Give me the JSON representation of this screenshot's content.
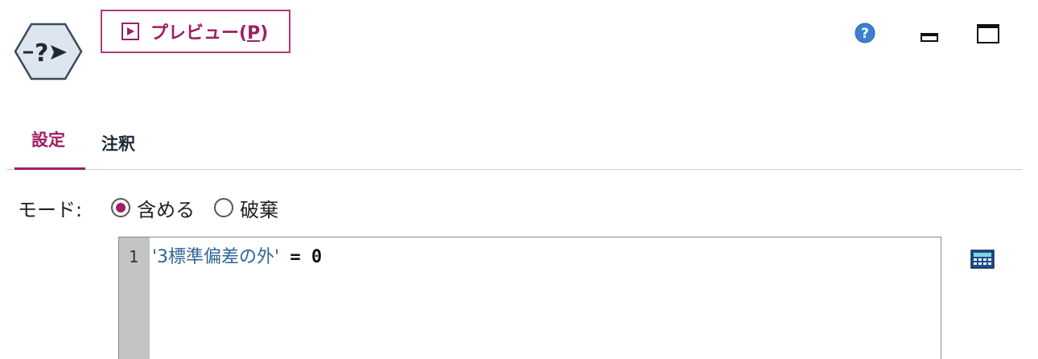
{
  "header": {
    "node_icon": "select-node-icon",
    "preview_button": {
      "icon": "play-icon",
      "label": "プレビュー(",
      "mnemonic": "P",
      "label_end": ")"
    },
    "window_controls": {
      "help_icon": "help-icon",
      "minimize_icon": "minimize-icon",
      "maximize_icon": "maximize-icon"
    }
  },
  "tabs": [
    {
      "label": "設定",
      "active": true
    },
    {
      "label": "注釈",
      "active": false
    }
  ],
  "mode": {
    "label": "モード:",
    "options": [
      {
        "label": "含める",
        "selected": true
      },
      {
        "label": "破棄",
        "selected": false
      }
    ]
  },
  "editor": {
    "line_number": "1",
    "field": "'3標準偏差の外'",
    "operator": "=",
    "value": "0",
    "calculator_icon": "calculator-icon"
  },
  "colors": {
    "accent": "#9e1f63",
    "field_text": "#2f6696",
    "gutter": "#c4c4c4"
  }
}
